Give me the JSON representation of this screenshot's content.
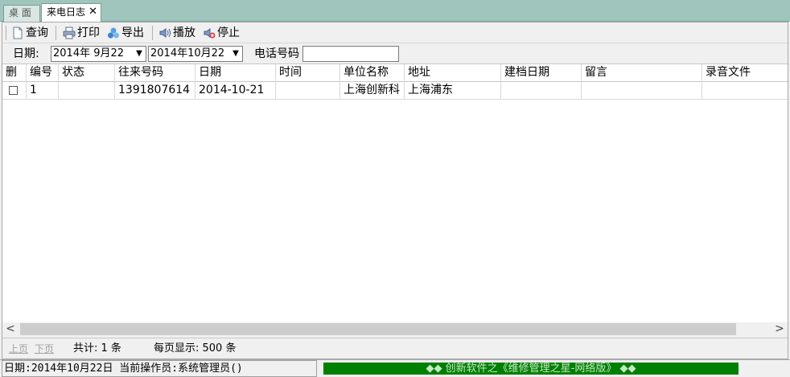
{
  "tabs": [
    {
      "label": "桌 面",
      "active": false
    },
    {
      "label": "来电日志",
      "active": true
    }
  ],
  "tab_close": "✕",
  "toolbar": {
    "query": "查询",
    "print": "打印",
    "export": "导出",
    "play": "播放",
    "stop": "停止"
  },
  "filter": {
    "date_label": "日期:",
    "date_from": "2014年  9月22",
    "date_to": "2014年10月22",
    "phone_label": "电话号码",
    "phone_value": ""
  },
  "grid": {
    "columns": [
      "删",
      "编号",
      "状态",
      "往来号码",
      "日期",
      "时间",
      "单位名称",
      "地址",
      "建档日期",
      "留言",
      "录音文件"
    ],
    "rows": [
      {
        "checked": false,
        "id": "1",
        "status": "",
        "number": "1391807614",
        "date": "2014-10-21",
        "time": "",
        "company": "上海创新科",
        "address": "上海浦东",
        "created": "",
        "message": "",
        "recording": ""
      }
    ]
  },
  "scrollbar": {
    "left": "<",
    "right": ">"
  },
  "pager": {
    "prev": "上页",
    "next": "下页",
    "total": "共计:  1 条",
    "per_page": "每页显示:  500 条"
  },
  "status": {
    "left": "日期:2014年10月22日 当前操作员:系统管理员()",
    "banner": "◆◆ 创新软件之《维修管理之星-网络版》 ◆◆"
  },
  "colors": {
    "tabbar": "#9fc5bc",
    "banner": "#008000"
  }
}
